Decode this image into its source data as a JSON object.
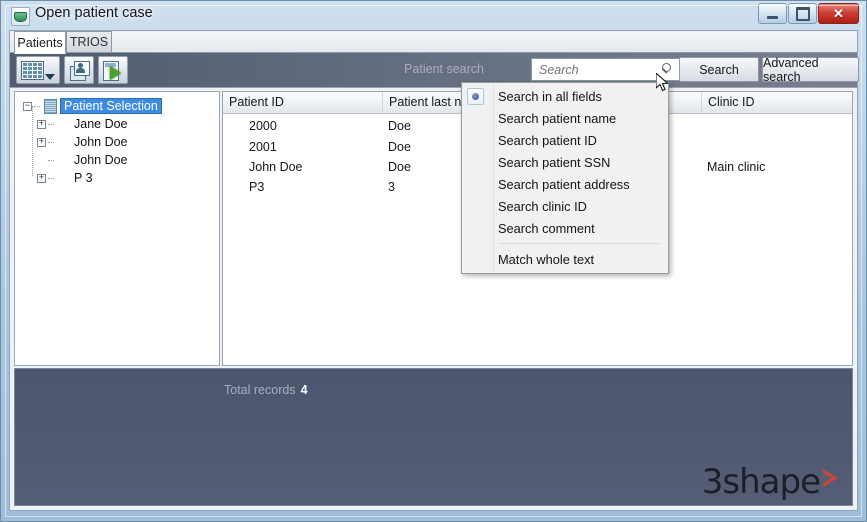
{
  "window": {
    "title": "Open patient case",
    "icon": "app-scanner-icon",
    "caption_buttons": {
      "minimize": "minimize-icon",
      "maximize": "restore-icon",
      "close": "close-icon"
    }
  },
  "tabs": [
    {
      "label": "Patients",
      "active": true
    },
    {
      "label": "TRIOS",
      "active": false
    }
  ],
  "toolbar": {
    "buttons": [
      {
        "name": "grid-view-button",
        "icon": "grid-icon"
      },
      {
        "name": "scan-documents-button",
        "icon": "scan-pages-icon"
      },
      {
        "name": "export-case-button",
        "icon": "export-arrow-icon"
      }
    ],
    "search_label": "Patient search",
    "search_placeholder": "Search",
    "search_value": "",
    "search_icon": "magnifier-icon",
    "search_button": "Search",
    "advanced_search_button": "Advanced search"
  },
  "tree": {
    "root": {
      "label": "Patient Selection",
      "selected": true,
      "expanded": true,
      "icon": "selection-folder-icon"
    },
    "items": [
      {
        "label": "Jane Doe",
        "expandable": true,
        "icon": "person-icon"
      },
      {
        "label": "John Doe",
        "expandable": true,
        "icon": "person-icon"
      },
      {
        "label": "John Doe",
        "expandable": false,
        "icon": "person-icon"
      },
      {
        "label": "P 3",
        "expandable": true,
        "icon": "person-icon"
      }
    ]
  },
  "table": {
    "columns": [
      "Patient ID",
      "Patient last name",
      "Clinic ID"
    ],
    "rows": [
      {
        "patient_id": "2000",
        "last_name": "Doe",
        "clinic_id": ""
      },
      {
        "patient_id": "2001",
        "last_name": "Doe",
        "clinic_id": ""
      },
      {
        "patient_id": "John Doe",
        "last_name": "Doe",
        "clinic_id": "Main clinic"
      },
      {
        "patient_id": "P3",
        "last_name": "3",
        "clinic_id": ""
      }
    ]
  },
  "context_menu": {
    "items": [
      {
        "label": "Search in all fields",
        "selected": true
      },
      {
        "label": "Search patient name",
        "selected": false
      },
      {
        "label": "Search patient ID",
        "selected": false
      },
      {
        "label": "Search patient SSN",
        "selected": false
      },
      {
        "label": "Search patient address",
        "selected": false
      },
      {
        "label": "Search clinic ID",
        "selected": false
      },
      {
        "label": "Search comment",
        "selected": false
      }
    ],
    "separator_after_index": 6,
    "footer_item": {
      "label": "Match whole text",
      "selected": false
    }
  },
  "status_bar": {
    "total_records_label": "Total records",
    "total_records_value": "4"
  },
  "branding": {
    "logo_text": "3shape",
    "logo_mark": "triangle-icon",
    "accent_color": "#c8473a"
  },
  "colors": {
    "selection_blue": "#3e8ce0",
    "toolbar_dark": "#5a6278",
    "panel_dark": "#4f5870"
  }
}
